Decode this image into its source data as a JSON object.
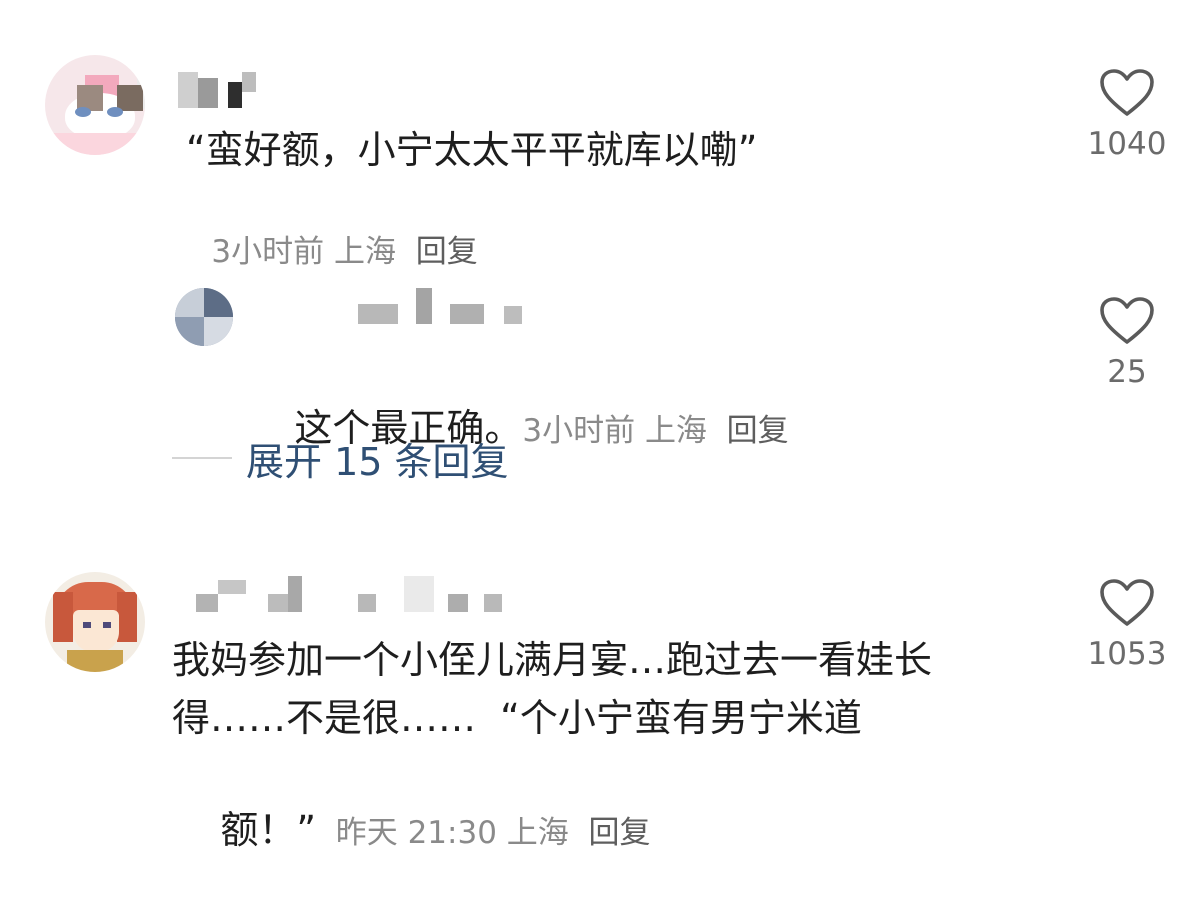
{
  "comments": [
    {
      "text": "“蛮好额，小宁太太平平就库以嘞”",
      "time": "3小时前",
      "location": "上海",
      "reply_label": "回复",
      "likes": "1040",
      "avatar": "cat-avatar"
    },
    {
      "text": "我妈参加一个小侄儿满月宴…跑过去一看娃长",
      "text_line2": "得……不是很……  “个小宁蛮有男宁米道",
      "text_line3": "额！”",
      "time": "昨天 21:30",
      "location": "上海",
      "reply_label": "回复",
      "likes": "1053",
      "avatar": "anime-avatar"
    }
  ],
  "reply": {
    "text": "这个最正确。",
    "time": "3小时前",
    "location": "上海",
    "reply_label": "回复",
    "likes": "25",
    "avatar": "blue-avatar"
  },
  "expand_replies": {
    "label": "展开 15 条回复"
  },
  "icons": {
    "like": "heart-outline-icon"
  },
  "colors": {
    "text": "#1e1e1e",
    "meta": "#8a8a8a",
    "link": "#2f4f74",
    "heart": "#5a5a5a"
  }
}
